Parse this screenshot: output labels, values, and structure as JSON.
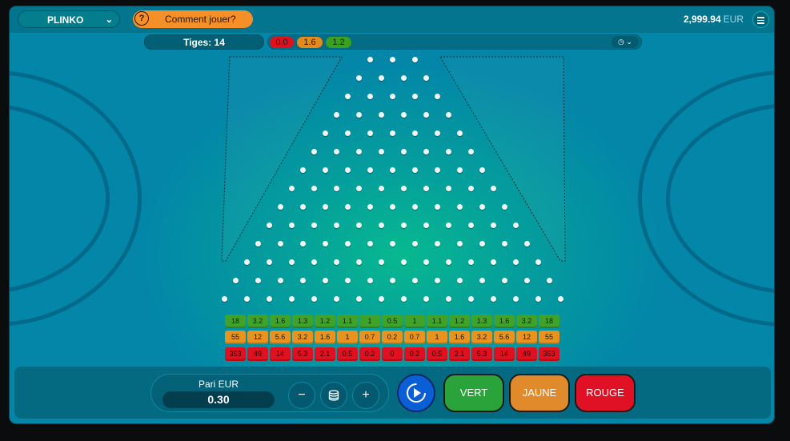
{
  "header": {
    "game_name": "PLINKO",
    "how_to_play": "Comment jouer?",
    "balance": "2,999.94",
    "currency": "EUR",
    "menu_icon": "hamburger-menu-icon"
  },
  "controls": {
    "pins_label": "Tiges: 14",
    "history": [
      {
        "value": "0.0",
        "color": "#e0101e"
      },
      {
        "value": "1.6",
        "color": "#e58a1c"
      },
      {
        "value": "1.2",
        "color": "#3aa020"
      }
    ],
    "history_toggle_icon": "history-clock-icon"
  },
  "board": {
    "pin_rows": 14,
    "multipliers": {
      "green": [
        "18",
        "3.2",
        "1.6",
        "1.3",
        "1.2",
        "1.1",
        "1",
        "0.5",
        "1",
        "1.1",
        "1.2",
        "1.3",
        "1.6",
        "3.2",
        "18"
      ],
      "yellow": [
        "55",
        "12",
        "5.6",
        "3.2",
        "1.6",
        "1",
        "0.7",
        "0.2",
        "0.7",
        "1",
        "1.6",
        "3.2",
        "5.6",
        "12",
        "55"
      ],
      "red": [
        "353",
        "49",
        "14",
        "5.3",
        "2.1",
        "0.5",
        "0.2",
        "0",
        "0.2",
        "0.5",
        "2.1",
        "5.3",
        "14",
        "49",
        "353"
      ]
    },
    "colors": {
      "green": "#3fa32a",
      "yellow": "#e8921f",
      "red": "#e01020"
    }
  },
  "bet": {
    "label": "Pari EUR",
    "value": "0.30",
    "minus": "−",
    "plus": "+",
    "stack_icon": "coin-stack-icon",
    "autoplay_icon": "autoplay-icon"
  },
  "play_buttons": [
    {
      "label": "VERT",
      "color": "#2aa43a"
    },
    {
      "label": "JAUNE",
      "color": "#e08a2c"
    },
    {
      "label": "ROUGE",
      "color": "#e01025"
    }
  ]
}
